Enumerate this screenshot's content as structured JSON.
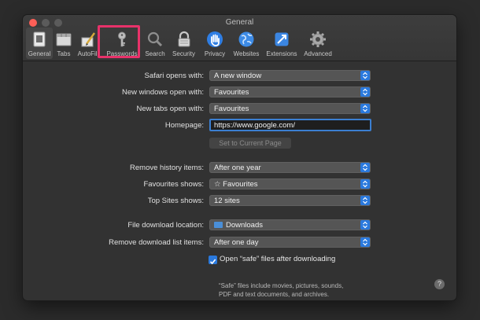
{
  "window": {
    "title": "General"
  },
  "toolbar": {
    "items": [
      {
        "label": "General",
        "icon": "general-icon"
      },
      {
        "label": "Tabs",
        "icon": "tabs-icon"
      },
      {
        "label": "AutoFill",
        "icon": "autofill-icon"
      },
      {
        "label": "Passwords",
        "icon": "key-icon"
      },
      {
        "label": "Search",
        "icon": "search-icon"
      },
      {
        "label": "Security",
        "icon": "lock-icon"
      },
      {
        "label": "Privacy",
        "icon": "hand-icon"
      },
      {
        "label": "Websites",
        "icon": "globe-icon"
      },
      {
        "label": "Extensions",
        "icon": "extensions-icon"
      },
      {
        "label": "Advanced",
        "icon": "gear-icon"
      }
    ],
    "selected": "General",
    "highlighted": "Passwords",
    "highlight_color": "#e8326a"
  },
  "settings": {
    "safari_opens_with": {
      "label": "Safari opens with:",
      "value": "A new window"
    },
    "new_windows_open_with": {
      "label": "New windows open with:",
      "value": "Favourites"
    },
    "new_tabs_open_with": {
      "label": "New tabs open with:",
      "value": "Favourites"
    },
    "homepage": {
      "label": "Homepage:",
      "value": "https://www.google.com/"
    },
    "set_current_page": {
      "label": "Set to Current Page"
    },
    "remove_history_items": {
      "label": "Remove history items:",
      "value": "After one year"
    },
    "favourites_shows": {
      "label": "Favourites shows:",
      "value": "☆ Favourites"
    },
    "top_sites_shows": {
      "label": "Top Sites shows:",
      "value": "12 sites"
    },
    "file_download_location": {
      "label": "File download location:",
      "value": "Downloads"
    },
    "remove_download_list_items": {
      "label": "Remove download list items:",
      "value": "After one day"
    },
    "open_safe_files": {
      "label": "Open “safe” files after downloading",
      "checked": true
    },
    "safe_note": "“Safe” files include movies, pictures, sounds, PDF and text documents, and archives."
  },
  "help": {
    "label": "?"
  },
  "colors": {
    "accent": "#2a79dd",
    "window_bg": "#323232"
  }
}
